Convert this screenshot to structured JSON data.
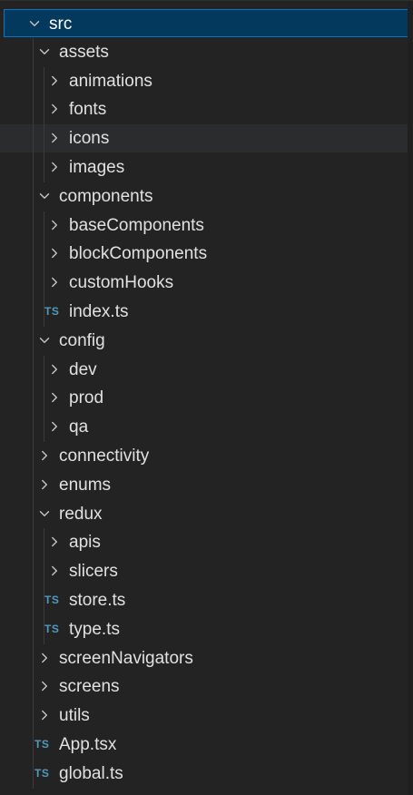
{
  "tree": [
    {
      "label": "src",
      "kind": "folder",
      "state": "open",
      "depth": 0,
      "selected": true
    },
    {
      "label": "assets",
      "kind": "folder",
      "state": "open",
      "depth": 1
    },
    {
      "label": "animations",
      "kind": "folder",
      "state": "closed",
      "depth": 2
    },
    {
      "label": "fonts",
      "kind": "folder",
      "state": "closed",
      "depth": 2
    },
    {
      "label": "icons",
      "kind": "folder",
      "state": "closed",
      "depth": 2,
      "hover": true
    },
    {
      "label": "images",
      "kind": "folder",
      "state": "closed",
      "depth": 2
    },
    {
      "label": "components",
      "kind": "folder",
      "state": "open",
      "depth": 1
    },
    {
      "label": "baseComponents",
      "kind": "folder",
      "state": "closed",
      "depth": 2
    },
    {
      "label": "blockComponents",
      "kind": "folder",
      "state": "closed",
      "depth": 2
    },
    {
      "label": "customHooks",
      "kind": "folder",
      "state": "closed",
      "depth": 2
    },
    {
      "label": "index.ts",
      "kind": "file",
      "icon": "TS",
      "depth": 2
    },
    {
      "label": "config",
      "kind": "folder",
      "state": "open",
      "depth": 1
    },
    {
      "label": "dev",
      "kind": "folder",
      "state": "closed",
      "depth": 2
    },
    {
      "label": "prod",
      "kind": "folder",
      "state": "closed",
      "depth": 2
    },
    {
      "label": "qa",
      "kind": "folder",
      "state": "closed",
      "depth": 2
    },
    {
      "label": "connectivity",
      "kind": "folder",
      "state": "closed",
      "depth": 1
    },
    {
      "label": "enums",
      "kind": "folder",
      "state": "closed",
      "depth": 1
    },
    {
      "label": "redux",
      "kind": "folder",
      "state": "open",
      "depth": 1
    },
    {
      "label": "apis",
      "kind": "folder",
      "state": "closed",
      "depth": 2
    },
    {
      "label": "slicers",
      "kind": "folder",
      "state": "closed",
      "depth": 2
    },
    {
      "label": "store.ts",
      "kind": "file",
      "icon": "TS",
      "depth": 2
    },
    {
      "label": "type.ts",
      "kind": "file",
      "icon": "TS",
      "depth": 2
    },
    {
      "label": "screenNavigators",
      "kind": "folder",
      "state": "closed",
      "depth": 1
    },
    {
      "label": "screens",
      "kind": "folder",
      "state": "closed",
      "depth": 1
    },
    {
      "label": "utils",
      "kind": "folder",
      "state": "closed",
      "depth": 1
    },
    {
      "label": "App.tsx",
      "kind": "file",
      "icon": "TS",
      "depth": 1
    },
    {
      "label": "global.ts",
      "kind": "file",
      "icon": "TS",
      "depth": 1
    }
  ],
  "colors": {
    "selection_bg": "#04395e",
    "selection_border": "#0f73c4",
    "ts_icon": "#519aba",
    "text": "#e1e1e1"
  }
}
